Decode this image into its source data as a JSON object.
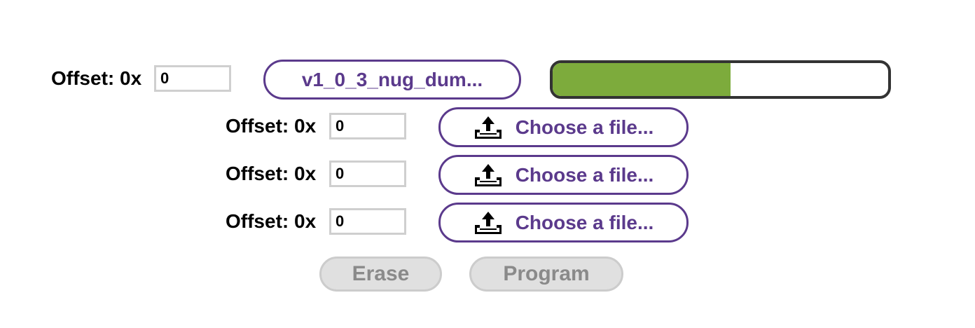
{
  "rows": [
    {
      "offset_label": "Offset: 0x",
      "offset_value": "0",
      "file_label": "v1_0_3_nug_dum...",
      "has_upload_icon": false
    },
    {
      "offset_label": "Offset: 0x",
      "offset_value": "0",
      "file_label": "Choose a file...",
      "has_upload_icon": true
    },
    {
      "offset_label": "Offset: 0x",
      "offset_value": "0",
      "file_label": "Choose a file...",
      "has_upload_icon": true
    },
    {
      "offset_label": "Offset: 0x",
      "offset_value": "0",
      "file_label": "Choose a file...",
      "has_upload_icon": true
    }
  ],
  "progress": {
    "fraction": 0.53
  },
  "actions": {
    "erase_label": "Erase",
    "program_label": "Program"
  },
  "colors": {
    "accent": "#5b3a8c",
    "progress_fill": "#7dab3c",
    "progress_border": "#333333",
    "disabled_bg": "#e0e0e0",
    "disabled_text": "#8a8a8a"
  },
  "icons": {
    "upload": "upload-tray-icon"
  }
}
